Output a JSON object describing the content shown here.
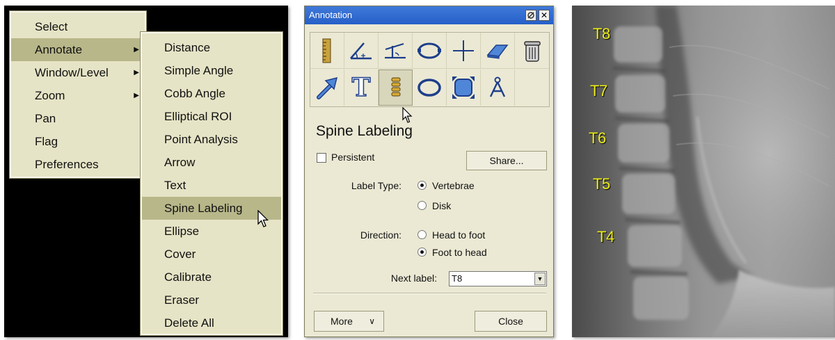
{
  "menu": {
    "main_items": [
      {
        "label": "Select",
        "has_submenu": false
      },
      {
        "label": "Annotate",
        "has_submenu": true
      },
      {
        "label": "Window/Level",
        "has_submenu": true
      },
      {
        "label": "Zoom",
        "has_submenu": true
      },
      {
        "label": "Pan",
        "has_submenu": false
      },
      {
        "label": "Flag",
        "has_submenu": false
      },
      {
        "label": "Preferences",
        "has_submenu": false
      }
    ],
    "highlighted_main": "Annotate",
    "sub_items": [
      {
        "label": "Distance"
      },
      {
        "label": "Simple Angle"
      },
      {
        "label": "Cobb Angle"
      },
      {
        "label": "Elliptical ROI"
      },
      {
        "label": "Point Analysis"
      },
      {
        "label": "Arrow"
      },
      {
        "label": "Text"
      },
      {
        "label": "Spine Labeling"
      },
      {
        "label": "Ellipse"
      },
      {
        "label": "Cover"
      },
      {
        "label": "Calibrate"
      },
      {
        "label": "Eraser"
      },
      {
        "label": "Delete All"
      }
    ],
    "highlighted_sub": "Spine Labeling",
    "submenu_arrow_icon": "triangle-right-icon",
    "colors": {
      "menu_bg": "#e6e4c6",
      "highlight": "#b8b78a",
      "backdrop": "#000000"
    }
  },
  "dialog": {
    "title": "Annotation",
    "title_buttons": [
      "pin-icon",
      "close-icon"
    ],
    "tools_row1": [
      "ruler-icon",
      "simple-angle-icon",
      "cobb-angle-icon",
      "elliptical-roi-icon",
      "crosshair-icon",
      "eraser-icon",
      "trash-can-icon"
    ],
    "tools_row2": [
      "arrow-icon",
      "text-icon",
      "spine-icon",
      "ellipse-icon",
      "cover-icon",
      "calibrate-icon"
    ],
    "active_tool": "spine-icon",
    "heading": "Spine Labeling",
    "persistent": {
      "label": "Persistent",
      "checked": false
    },
    "share_label": "Share...",
    "label_type": {
      "label": "Label Type:",
      "options": [
        "Vertebrae",
        "Disk"
      ],
      "selected": "Vertebrae"
    },
    "direction": {
      "label": "Direction:",
      "options": [
        "Head to foot",
        "Foot to head"
      ],
      "selected": "Foot to head"
    },
    "next_label": {
      "label": "Next label:",
      "value": "T8"
    },
    "more_label": "More",
    "close_label": "Close",
    "colors": {
      "titlebar": "#2f6bd2",
      "body": "#ebe9d4"
    }
  },
  "xray": {
    "vertebra_labels": [
      "T8",
      "T7",
      "T6",
      "T5",
      "T4"
    ],
    "label_color": "#ecec18"
  }
}
